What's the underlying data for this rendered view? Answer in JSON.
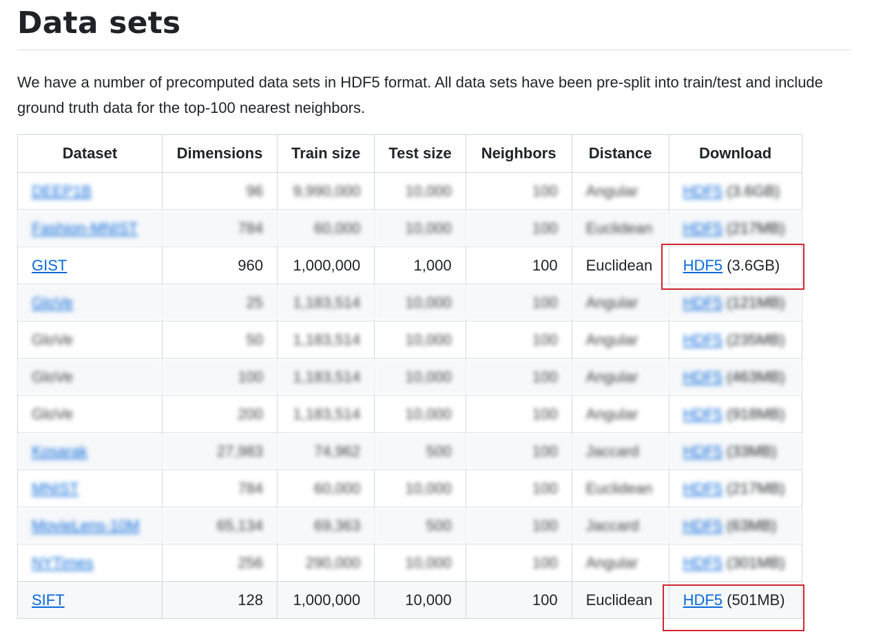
{
  "page": {
    "title": "Data sets",
    "intro": "We have a number of precomputed data sets in HDF5 format. All data sets have been pre-split into train/test and include ground truth data for the top-100 nearest neighbors."
  },
  "table": {
    "headers": [
      "Dataset",
      "Dimensions",
      "Train size",
      "Test size",
      "Neighbors",
      "Distance",
      "Download"
    ],
    "rows": [
      {
        "dataset": "DEEP1B",
        "linked": true,
        "dimensions": "96",
        "train": "9,990,000",
        "test": "10,000",
        "neighbors": "100",
        "distance": "Angular",
        "download": "HDF5",
        "size": "(3.6GB)",
        "blurred": true
      },
      {
        "dataset": "Fashion-MNIST",
        "linked": true,
        "dimensions": "784",
        "train": "60,000",
        "test": "10,000",
        "neighbors": "100",
        "distance": "Euclidean",
        "download": "HDF5",
        "size": "(217MB)",
        "blurred": true
      },
      {
        "dataset": "GIST",
        "linked": true,
        "dimensions": "960",
        "train": "1,000,000",
        "test": "1,000",
        "neighbors": "100",
        "distance": "Euclidean",
        "download": "HDF5",
        "size": "(3.6GB)",
        "blurred": false
      },
      {
        "dataset": "GloVe",
        "linked": true,
        "dimensions": "25",
        "train": "1,183,514",
        "test": "10,000",
        "neighbors": "100",
        "distance": "Angular",
        "download": "HDF5",
        "size": "(121MB)",
        "blurred": true
      },
      {
        "dataset": "GloVe",
        "linked": false,
        "dimensions": "50",
        "train": "1,183,514",
        "test": "10,000",
        "neighbors": "100",
        "distance": "Angular",
        "download": "HDF5",
        "size": "(235MB)",
        "blurred": true
      },
      {
        "dataset": "GloVe",
        "linked": false,
        "dimensions": "100",
        "train": "1,183,514",
        "test": "10,000",
        "neighbors": "100",
        "distance": "Angular",
        "download": "HDF5",
        "size": "(463MB)",
        "blurred": true
      },
      {
        "dataset": "GloVe",
        "linked": false,
        "dimensions": "200",
        "train": "1,183,514",
        "test": "10,000",
        "neighbors": "100",
        "distance": "Angular",
        "download": "HDF5",
        "size": "(918MB)",
        "blurred": true
      },
      {
        "dataset": "Kosarak",
        "linked": true,
        "dimensions": "27,983",
        "train": "74,962",
        "test": "500",
        "neighbors": "100",
        "distance": "Jaccard",
        "download": "HDF5",
        "size": "(33MB)",
        "blurred": true
      },
      {
        "dataset": "MNIST",
        "linked": true,
        "dimensions": "784",
        "train": "60,000",
        "test": "10,000",
        "neighbors": "100",
        "distance": "Euclidean",
        "download": "HDF5",
        "size": "(217MB)",
        "blurred": true
      },
      {
        "dataset": "MovieLens-10M",
        "linked": true,
        "dimensions": "65,134",
        "train": "69,363",
        "test": "500",
        "neighbors": "100",
        "distance": "Jaccard",
        "download": "HDF5",
        "size": "(63MB)",
        "blurred": true
      },
      {
        "dataset": "NYTimes",
        "linked": true,
        "dimensions": "256",
        "train": "290,000",
        "test": "10,000",
        "neighbors": "100",
        "distance": "Angular",
        "download": "HDF5",
        "size": "(301MB)",
        "blurred": true
      },
      {
        "dataset": "SIFT",
        "linked": true,
        "dimensions": "128",
        "train": "1,000,000",
        "test": "10,000",
        "neighbors": "100",
        "distance": "Euclidean",
        "download": "HDF5",
        "size": "(501MB)",
        "blurred": false
      }
    ]
  },
  "colors": {
    "link": "#0969da",
    "highlight": "#d1242f",
    "alt_row": "#f6f8fa",
    "border": "#d0d7de"
  }
}
